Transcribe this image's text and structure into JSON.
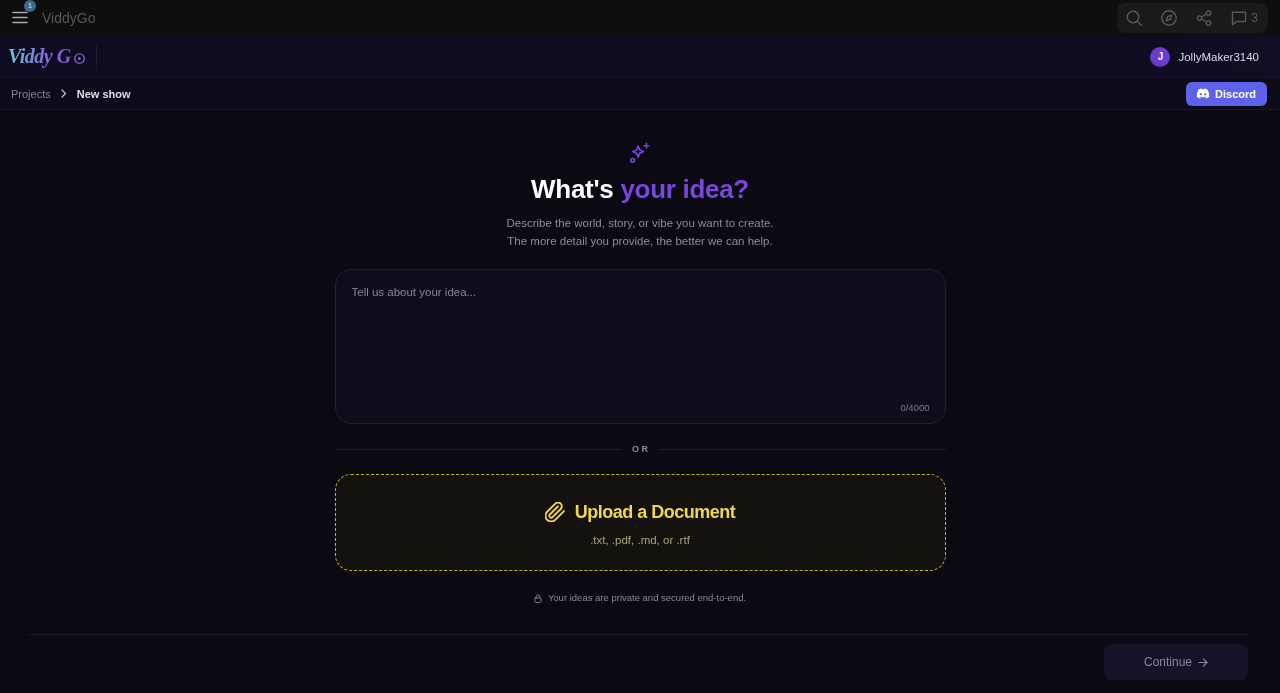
{
  "top_bar": {
    "notification_count": "1",
    "title": "ViddyGo",
    "comment_count": "3"
  },
  "header": {
    "logo": "Viddy G",
    "user": {
      "initial": "J",
      "name": "JollyMaker3140"
    }
  },
  "breadcrumb": [
    {
      "label": "Projects",
      "selected": false
    },
    {
      "label": "New show",
      "selected": true
    }
  ],
  "discord_button": "Discord",
  "hero": {
    "heading": "What's",
    "heading_highlight": "your idea?",
    "subtitle": [
      "Describe the world, story, or vibe you want to create.",
      "The more detail you provide, the better we can help."
    ]
  },
  "idea_field": {
    "placeholder": "Tell us about your idea...",
    "counter": "0/4000"
  },
  "divider_label": "OR",
  "upload": {
    "title": "Upload a Document",
    "formats": ".txt, .pdf, .md, or .rtf"
  },
  "privacy_note": "Your ideas are private and secured end-to-end.",
  "continue_button": {
    "label": "Continue",
    "disabled": true
  }
}
